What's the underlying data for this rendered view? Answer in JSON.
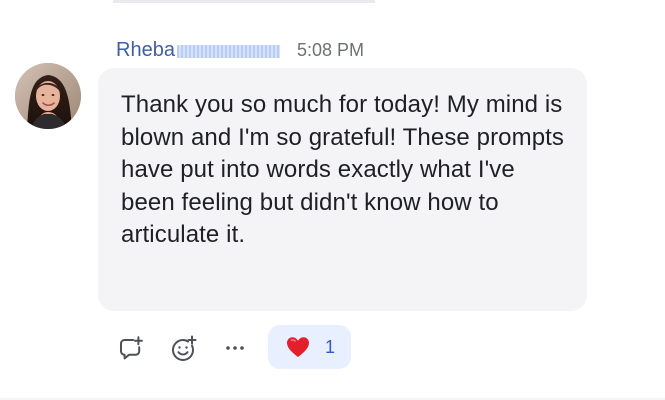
{
  "message": {
    "author": "Rheba",
    "time": "5:08 PM",
    "text": "Thank you so much for today! My mind is blown and I'm so grateful! These prompts have put into words exactly what I've been feeling but didn't know how to articulate it."
  },
  "actions": {
    "reply_icon": "speech-bubble-plus-icon",
    "emoji_icon": "smiley-plus-icon",
    "more_icon": "ellipsis-icon"
  },
  "reaction": {
    "emoji": "red-heart",
    "count": "1"
  },
  "colors": {
    "author": "#3d5fa3",
    "bubble": "#f4f4f7",
    "reaction_bg": "#e8efff",
    "reaction_count": "#315ac7"
  }
}
